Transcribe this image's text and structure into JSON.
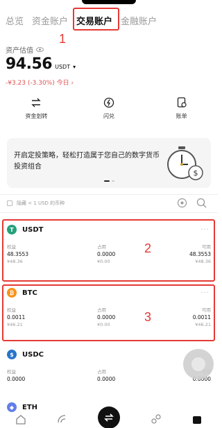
{
  "tabs": [
    {
      "label": "总览"
    },
    {
      "label": "资金账户"
    },
    {
      "label": "交易账户",
      "active": true
    },
    {
      "label": "金融账户"
    }
  ],
  "annotations": [
    "1",
    "2",
    "3"
  ],
  "estimate": {
    "label": "资产估值",
    "amount": "94.56",
    "unit": "USDT",
    "change": "-¥3.23 (-3.30%) 今日 ›"
  },
  "actions": [
    {
      "label": "资金划转",
      "icon": "transfer-icon"
    },
    {
      "label": "闪兑",
      "icon": "flash-convert-icon"
    },
    {
      "label": "账单",
      "icon": "bill-icon"
    }
  ],
  "banner": {
    "text": "开启定投策略，轻松打造属于您自己的数字货币投资组合",
    "icon": "stopwatch-coin-icon"
  },
  "filter": {
    "hide_small_label": "隐藏 < 1 USD 的币种"
  },
  "assets": [
    {
      "name": "USDT",
      "color": "#26a17b",
      "glyph": "T",
      "equity_label": "权益",
      "equity": "48.3553",
      "equity_cny": "¥48.36",
      "used_label": "占用",
      "used": "0.0000",
      "used_cny": "¥0.00",
      "avail_label": "可用",
      "avail": "48.3553",
      "avail_cny": "¥48.36"
    },
    {
      "name": "BTC",
      "color": "#f7931a",
      "glyph": "₿",
      "equity_label": "权益",
      "equity": "0.0011",
      "equity_cny": "¥46.21",
      "used_label": "占用",
      "used": "0.0000",
      "used_cny": "¥0.00",
      "avail_label": "可用",
      "avail": "0.0011",
      "avail_cny": "¥46.21"
    },
    {
      "name": "USDC",
      "color": "#2775ca",
      "glyph": "$",
      "equity_label": "权益",
      "equity": "0.0000",
      "equity_cny": "",
      "used_label": "占用",
      "used": "0.0000",
      "used_cny": "",
      "avail_label": "可用",
      "avail": "0.0000",
      "avail_cny": ""
    },
    {
      "name": "ETH",
      "color": "#627eea",
      "glyph": "◆"
    }
  ],
  "more_glyph": "···",
  "colors": {
    "accent_red": "#e53935",
    "negative": "#e05050"
  }
}
